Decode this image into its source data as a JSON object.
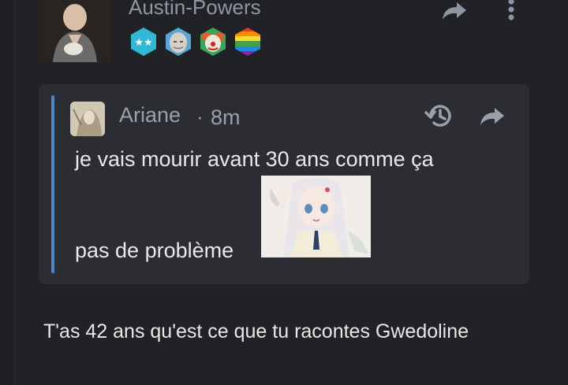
{
  "post": {
    "username": "Austin-Powers",
    "avatar_icon": "bald-man-avatar",
    "badges": [
      {
        "icon": "stars-badge-icon",
        "color": "#2fb9d6"
      },
      {
        "icon": "meme-face-badge-icon",
        "color": "#d7d0c4"
      },
      {
        "icon": "clown-badge-icon",
        "color": "#e25b2a"
      },
      {
        "icon": "rainbow-badge-icon",
        "color": "#6a5acd"
      }
    ],
    "share_icon": "share-arrow-icon",
    "more_icon": "more-vertical-icon"
  },
  "quote": {
    "author": "Ariane",
    "separator": "·",
    "time": "8m",
    "line1": "je vais mourir avant 30 ans comme ça",
    "line2": "pas de problème",
    "image_icon": "anime-girl-sticker",
    "history_icon": "history-icon",
    "share_icon": "share-arrow-icon"
  },
  "reply": {
    "text": "T'as 42 ans qu'est ce que tu racontes Gwedoline"
  },
  "colors": {
    "background": "#202226",
    "quote_bg": "#2b2d33",
    "quote_bar": "#4a88c8",
    "muted_text": "#8f96a3",
    "text": "#e8e8e8"
  }
}
